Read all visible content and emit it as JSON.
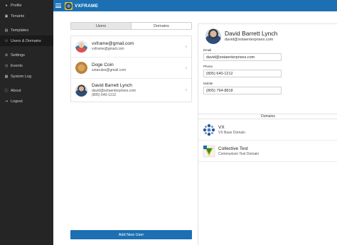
{
  "app": {
    "title": "VXFRAME"
  },
  "sidebar": {
    "items": [
      {
        "label": "Profile",
        "icon": "user-icon"
      },
      {
        "label": "Tenants",
        "icon": "building-icon"
      },
      {
        "label": "Templates",
        "icon": "document-icon"
      },
      {
        "label": "Users & Domains",
        "icon": "users-icon"
      },
      {
        "label": "Settings",
        "icon": "gear-icon"
      },
      {
        "label": "Events",
        "icon": "clock-icon"
      },
      {
        "label": "System Log",
        "icon": "log-icon"
      },
      {
        "label": "About",
        "icon": "info-icon"
      },
      {
        "label": "Logout",
        "icon": "logout-icon"
      }
    ]
  },
  "tabs": [
    {
      "label": "Users"
    },
    {
      "label": "Domains"
    }
  ],
  "users": [
    {
      "name": "vxframe@gmail.com",
      "lines": [
        "vxframe@gmail.com"
      ]
    },
    {
      "name": "Doge Coin",
      "lines": [
        "sotarules@gmail.com"
      ]
    },
    {
      "name": "David Barrett Lynch",
      "lines": [
        "david@sotaenterprises.com",
        "(805) 640-1212"
      ]
    }
  ],
  "add_button": {
    "label": "Add New User"
  },
  "detail": {
    "name": "David Barrett Lynch",
    "subtitle": "david@sotaenterprises.com",
    "fields": [
      {
        "label": "Email",
        "value": "david@sotaenterprises.com"
      },
      {
        "label": "Phone",
        "value": "(805) 640-1212"
      },
      {
        "label": "Mobile",
        "value": "(805) 794-8818"
      }
    ],
    "domains_heading": "Domains",
    "domains": [
      {
        "name": "VX",
        "description": "VX Base Domain"
      },
      {
        "name": "Collective Test",
        "description": "Communism Test Domain"
      }
    ]
  },
  "colors": {
    "accent": "#1b6fb2",
    "sidebar": "#252525"
  }
}
